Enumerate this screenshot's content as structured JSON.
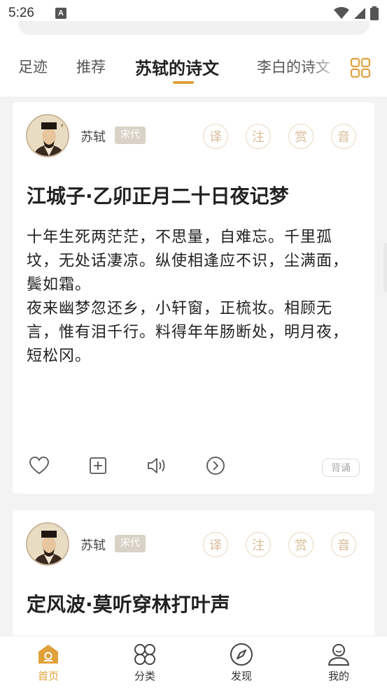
{
  "status_bar": {
    "time": "5:26",
    "notif_icon": "A"
  },
  "tabs": [
    {
      "label": "足迹"
    },
    {
      "label": "推荐"
    },
    {
      "label": "苏轼的诗文",
      "active": true
    },
    {
      "label": "李白的诗文"
    }
  ],
  "accent_color": "#e0a13b",
  "card_actions": {
    "translate": "译",
    "annotate": "注",
    "appreciate": "赏",
    "audio": "音"
  },
  "poems": [
    {
      "author": "苏轼",
      "dynasty": "宋代",
      "title": "江城子·乙卯正月二十日夜记梦",
      "paragraphs": [
        "十年生死两茫茫，不思量，自难忘。千里孤坟，无处话凄凉。纵使相逢应不识，尘满面，鬓如霜。",
        "夜来幽梦忽还乡，小轩窗，正梳妆。相顾无言，惟有泪千行。料得年年肠断处，明月夜，短松冈。"
      ],
      "recite_label": "背诵"
    },
    {
      "author": "苏轼",
      "dynasty": "宋代",
      "title": "定风波·莫听穿林打叶声"
    }
  ],
  "bottom_nav": [
    {
      "label": "首页",
      "icon": "home-icon",
      "active": true
    },
    {
      "label": "分类",
      "icon": "category-icon"
    },
    {
      "label": "发现",
      "icon": "compass-icon"
    },
    {
      "label": "我的",
      "icon": "profile-icon"
    }
  ]
}
